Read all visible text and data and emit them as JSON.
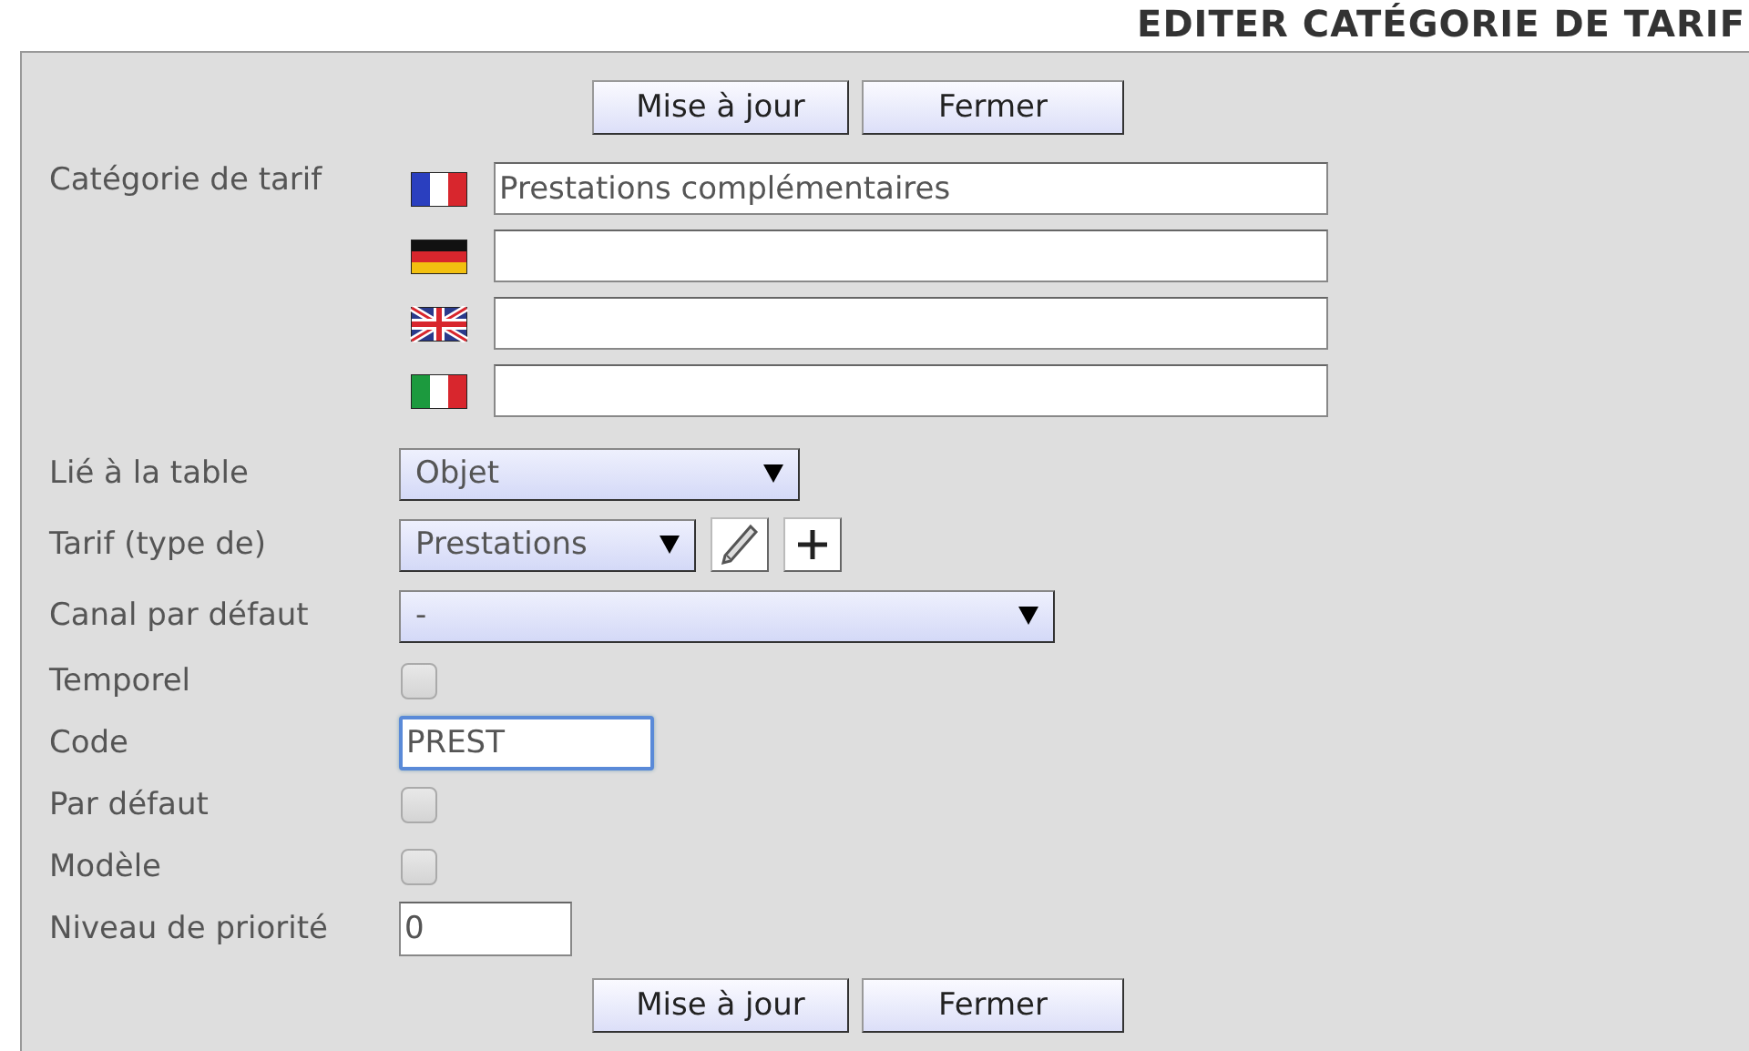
{
  "title": "EDITER CATÉGORIE DE TARIF",
  "top_buttons": [
    {
      "label": "Mise à jour"
    },
    {
      "label": "Fermer"
    }
  ],
  "category": {
    "label": "Catégorie de tarif",
    "translations": [
      {
        "kind": "fr",
        "value": "Prestations complémentaires"
      },
      {
        "kind": "de"
      },
      {
        "kind": "gb"
      },
      {
        "kind": "it"
      }
    ]
  },
  "fields": [
    {
      "kind": "select",
      "label": "Lié à la table",
      "value": "Objet"
    },
    {
      "kind": "select_tools",
      "label": "Tarif (type de)",
      "value": "Prestations"
    },
    {
      "kind": "select",
      "label": "Canal par défaut",
      "value": "-"
    },
    {
      "kind": "checkbox",
      "label": "Temporel",
      "checked": false
    },
    {
      "kind": "text",
      "label": "Code",
      "value": "PREST",
      "focused": true
    },
    {
      "kind": "checkbox",
      "label": "Par défaut",
      "checked": false
    },
    {
      "kind": "checkbox",
      "label": "Modèle",
      "checked": false
    },
    {
      "kind": "text",
      "label": "Niveau de priorité",
      "value": "0",
      "focused": false
    }
  ],
  "bottom_buttons": [
    {
      "label": "Mise à jour"
    },
    {
      "label": "Fermer"
    }
  ]
}
